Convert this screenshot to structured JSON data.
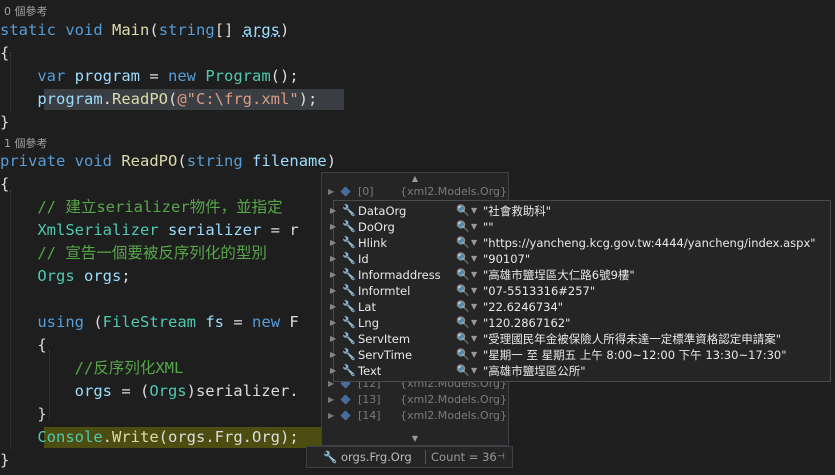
{
  "code": {
    "ref_main": "0 個參考",
    "ref_readpo": "1 個參考",
    "l_static": "static",
    "l_void": "void",
    "l_main": "Main",
    "l_string": "string",
    "l_args": "args",
    "l_var": "var",
    "l_program": "program",
    "l_new": "new",
    "l_Program": "Program",
    "l_readpo": "ReadPO",
    "l_path": "@\"C:\\frg.xml\"",
    "l_private": "private",
    "l_filename": "filename",
    "cm_1": "// 建立serializer物件，並指定",
    "l_XmlSerializer": "XmlSerializer",
    "l_serializer": "serializer",
    "l_eq_r": "= r",
    "cm_2": "// 宣告一個要被反序列化的型別",
    "l_Orgs": "Orgs",
    "l_orgs": "orgs",
    "l_using": "using",
    "l_FileStream": "FileStream",
    "l_fs": "fs",
    "l_eq_new": "= new F",
    "cm_3": "//反序列化XML",
    "l_orgs_assign": "orgs = (",
    "l_serializer_dot": ")serializer.",
    "l_Console": "Console",
    "l_Write": "Write",
    "l_orgsFrgOrg": "orgs.Frg.Org"
  },
  "datatip": {
    "row0_name": "[0]",
    "row0_value": "{xml2.Models.Org}",
    "row12_name": "[12]",
    "row12_value": "{xml2.Models.Org}",
    "row13_name": "[13]",
    "row13_value": "{xml2.Models.Org}",
    "row14_name": "[14]",
    "row14_value": "{xml2.Models.Org}",
    "properties": [
      {
        "name": "DataOrg",
        "value": "\"社會救助科\""
      },
      {
        "name": "DoOrg",
        "value": "\"\""
      },
      {
        "name": "Hlink",
        "value": "\"https://yancheng.kcg.gov.tw:4444/yancheng/index.aspx\""
      },
      {
        "name": "Id",
        "value": "\"90107\""
      },
      {
        "name": "Informaddress",
        "value": "\"高雄市鹽埕區大仁路6號9樓\""
      },
      {
        "name": "Informtel",
        "value": "\"07-5513316#257\""
      },
      {
        "name": "Lat",
        "value": "\"22.6246734\""
      },
      {
        "name": "Lng",
        "value": "\"120.2867162\""
      },
      {
        "name": "ServItem",
        "value": "\"受理國民年金被保險人所得未達一定標準資格認定申請案\""
      },
      {
        "name": "ServTime",
        "value": "\"星期一 至 星期五 上午 8:00~12:00 下午 13:30~17:30\""
      },
      {
        "name": "Text",
        "value": "\"高雄市鹽埕區公所\""
      }
    ],
    "footer_expression": "orgs.Frg.Org",
    "footer_count": "Count = 36"
  },
  "icons": {
    "wrench": "wrench-icon",
    "search": "magnifier-icon",
    "expand": "expand-arrow-icon",
    "pin": "pin-icon"
  }
}
